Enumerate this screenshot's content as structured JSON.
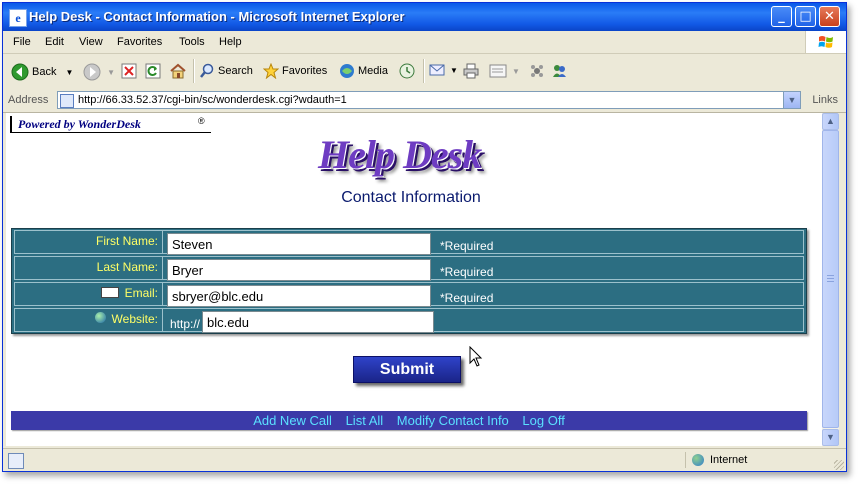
{
  "window": {
    "title": "Help Desk - Contact Information - Microsoft Internet Explorer",
    "app_icon": "ie-page-icon",
    "buttons": {
      "minimize": "_",
      "maximize": "□",
      "close": "✕"
    }
  },
  "menubar": {
    "items": [
      "File",
      "Edit",
      "View",
      "Favorites",
      "Tools",
      "Help"
    ]
  },
  "toolbar": {
    "back_label": "Back",
    "search_label": "Search",
    "favorites_label": "Favorites",
    "media_label": "Media"
  },
  "addressbar": {
    "label": "Address",
    "url": "http://66.33.52.37/cgi-bin/sc/wonderdesk.cgi?wdauth=1",
    "links_label": "Links"
  },
  "page": {
    "powered_by": "Powered by WonderDesk",
    "registered": "®",
    "logo_text": "Help Desk",
    "subtitle": "Contact Information",
    "form": {
      "first_name": {
        "label": "First Name:",
        "value": "Steven",
        "note": "*Required"
      },
      "last_name": {
        "label": "Last Name:",
        "value": "Bryer",
        "note": "*Required"
      },
      "email": {
        "label": "Email:",
        "value": "sbryer@blc.edu",
        "note": "*Required"
      },
      "website": {
        "label": "Website:",
        "prefix": "http://",
        "value": "blc.edu"
      }
    },
    "submit_label": "Submit",
    "nav": [
      "Add New Call",
      "List All",
      "Modify Contact Info",
      "Log Off"
    ]
  },
  "statusbar": {
    "zone": "Internet"
  },
  "colors": {
    "titlebar": "#0a58e8",
    "form_bg": "#2c6e82",
    "label_yellow": "#ffff66",
    "nav_bg": "#3b3aa8",
    "nav_link": "#5ae1ff",
    "submit_bg": "#1a2488",
    "heading": "#0a1a6e"
  }
}
